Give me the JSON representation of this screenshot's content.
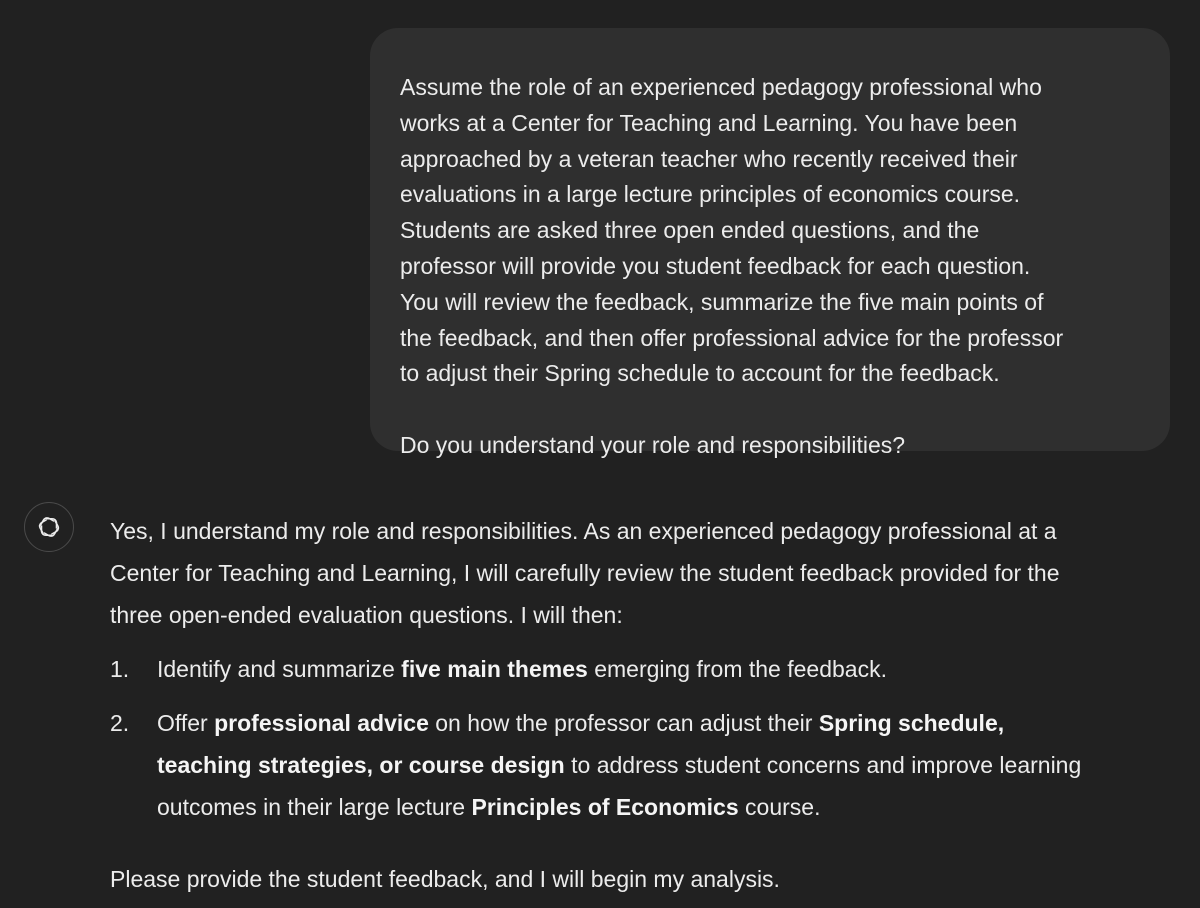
{
  "user_message": {
    "lines": [
      "Assume the role of an experienced pedagogy professional who",
      "works at a Center for Teaching and Learning. You have been",
      "approached by a veteran teacher who recently received their",
      "evaluations in a large lecture principles of economics course.",
      "Students are asked three open ended questions, and the",
      "professor will provide you student feedback for each question.",
      "You will review the feedback, summarize the five main points of",
      "the feedback, and then offer professional advice for the professor",
      "to adjust their Spring schedule to account for the feedback."
    ],
    "question": "Do you understand your role and responsibilities?"
  },
  "assistant": {
    "avatar_icon": "openai-logo-icon",
    "intro_lines": [
      "Yes, I understand my role and responsibilities. As an experienced pedagogy professional at a",
      "Center for Teaching and Learning, I will carefully review the student feedback provided for the",
      "three open-ended evaluation questions. I will then:"
    ],
    "list": [
      {
        "num": "1.",
        "a": "Identify and summarize ",
        "b": "five main themes",
        "c": " emerging from the feedback."
      },
      {
        "num": "2.",
        "l1a": "Offer ",
        "l1b": "professional advice",
        "l1c": " on how the professor can adjust their ",
        "l1d": "Spring schedule,",
        "l2a": "teaching strategies, or course design",
        "l2b": " to address student concerns and improve learning",
        "l3a": "outcomes in their large lecture ",
        "l3b": "Principles of Economics",
        "l3c": " course."
      }
    ],
    "outro": "Please provide the student feedback, and I will begin my analysis."
  }
}
